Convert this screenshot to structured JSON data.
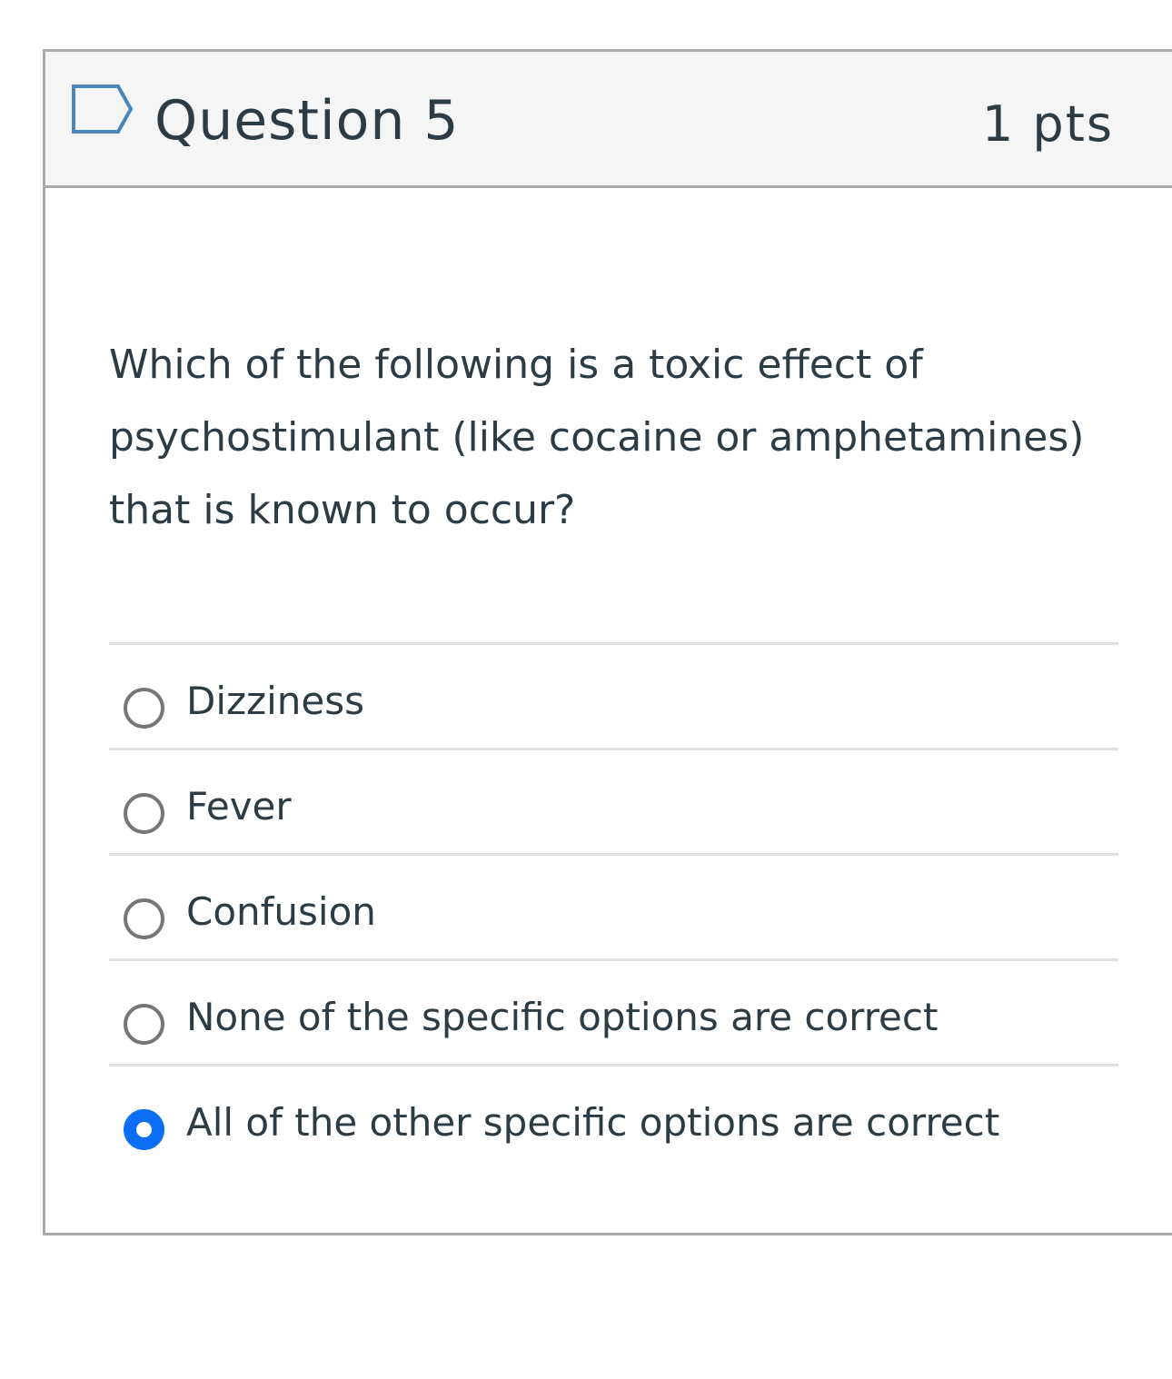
{
  "question": {
    "title": "Question 5",
    "points": "1 pts",
    "flag_icon": "flag-outline-icon",
    "text": "Which of the following is a toxic effect of psychostimulant (like cocaine or amphetamines) that is known to occur?"
  },
  "answers": [
    {
      "label": "Dizziness",
      "selected": false
    },
    {
      "label": "Fever",
      "selected": false
    },
    {
      "label": "Confusion",
      "selected": false
    },
    {
      "label": "None of the specific options are correct",
      "selected": false
    },
    {
      "label": "All of the other specific options are correct",
      "selected": true
    }
  ],
  "colors": {
    "selected_radio": "#0b6ef5",
    "flag_outline": "#4a86b8",
    "text": "#2d3b45"
  }
}
